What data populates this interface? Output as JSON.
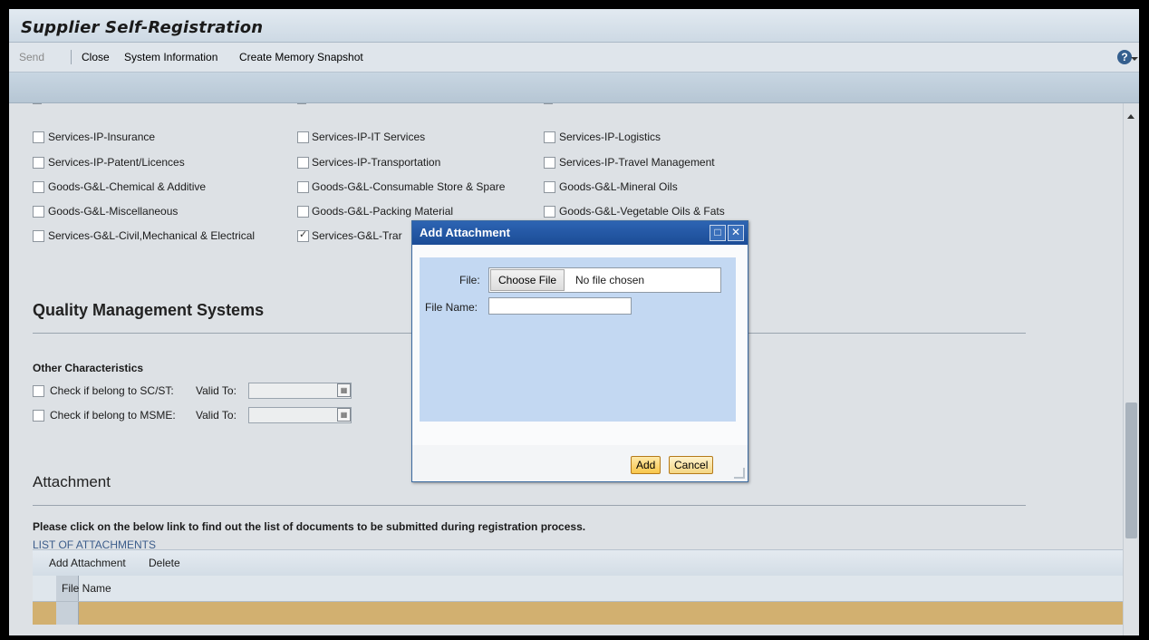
{
  "window": {
    "title": "Supplier Self-Registration"
  },
  "toolbar": {
    "send": "Send",
    "close": "Close",
    "system_info": "System Information",
    "create_snapshot": "Create Memory Snapshot",
    "help_icon": "help-icon"
  },
  "categories": [
    {
      "label": "Services-IP-Insurance",
      "checked": false
    },
    {
      "label": "Services-IP-IT Services",
      "checked": false
    },
    {
      "label": "Services-IP-Logistics",
      "checked": false
    },
    {
      "label": "Services-IP-Patent/Licences",
      "checked": false
    },
    {
      "label": "Services-IP-Transportation",
      "checked": false
    },
    {
      "label": "Services-IP-Travel Management",
      "checked": false
    },
    {
      "label": "Goods-G&L-Chemical & Additive",
      "checked": false
    },
    {
      "label": "Goods-G&L-Consumable Store & Spare",
      "checked": false
    },
    {
      "label": "Goods-G&L-Mineral Oils",
      "checked": false
    },
    {
      "label": "Goods-G&L-Miscellaneous",
      "checked": false
    },
    {
      "label": "Goods-G&L-Packing Material",
      "checked": false
    },
    {
      "label": "Goods-G&L-Vegetable Oils & Fats",
      "checked": false
    },
    {
      "label": "Services-G&L-Civil,Mechanical & Electrical",
      "checked": false
    },
    {
      "label": "Services-G&L-Trar",
      "checked": true
    }
  ],
  "qms": {
    "heading": "Quality Management Systems",
    "other_heading": "Other Characteristics",
    "sc_st_label": "Check if belong to SC/ST:",
    "msme_label": "Check if belong to MSME:",
    "valid_to": "Valid To:"
  },
  "attachment": {
    "heading": "Attachment",
    "instruction": "Please click on the below link to find out the list of documents to be submitted during registration process.",
    "link": "LIST OF ATTACHMENTS",
    "add_label": "Add Attachment",
    "delete_label": "Delete",
    "col_file_name": "File Name"
  },
  "modal": {
    "title": "Add Attachment",
    "file_label": "File:",
    "choose_file": "Choose File",
    "no_file": "No file chosen",
    "file_name_label": "File Name:",
    "file_name_value": "",
    "add_button": "Add",
    "cancel_button": "Cancel"
  },
  "colors": {
    "accent": "#1b4c96",
    "row_selected": "#d2b070"
  }
}
